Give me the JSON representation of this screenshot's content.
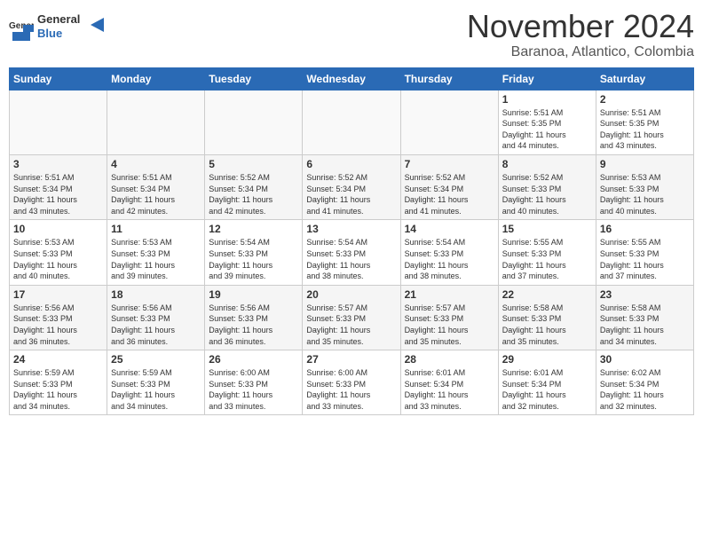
{
  "logo": {
    "general": "General",
    "blue": "Blue"
  },
  "title": "November 2024",
  "subtitle": "Baranoa, Atlantico, Colombia",
  "weekdays": [
    "Sunday",
    "Monday",
    "Tuesday",
    "Wednesday",
    "Thursday",
    "Friday",
    "Saturday"
  ],
  "weeks": [
    [
      {
        "day": "",
        "info": ""
      },
      {
        "day": "",
        "info": ""
      },
      {
        "day": "",
        "info": ""
      },
      {
        "day": "",
        "info": ""
      },
      {
        "day": "",
        "info": ""
      },
      {
        "day": "1",
        "info": "Sunrise: 5:51 AM\nSunset: 5:35 PM\nDaylight: 11 hours\nand 44 minutes."
      },
      {
        "day": "2",
        "info": "Sunrise: 5:51 AM\nSunset: 5:35 PM\nDaylight: 11 hours\nand 43 minutes."
      }
    ],
    [
      {
        "day": "3",
        "info": "Sunrise: 5:51 AM\nSunset: 5:34 PM\nDaylight: 11 hours\nand 43 minutes."
      },
      {
        "day": "4",
        "info": "Sunrise: 5:51 AM\nSunset: 5:34 PM\nDaylight: 11 hours\nand 42 minutes."
      },
      {
        "day": "5",
        "info": "Sunrise: 5:52 AM\nSunset: 5:34 PM\nDaylight: 11 hours\nand 42 minutes."
      },
      {
        "day": "6",
        "info": "Sunrise: 5:52 AM\nSunset: 5:34 PM\nDaylight: 11 hours\nand 41 minutes."
      },
      {
        "day": "7",
        "info": "Sunrise: 5:52 AM\nSunset: 5:34 PM\nDaylight: 11 hours\nand 41 minutes."
      },
      {
        "day": "8",
        "info": "Sunrise: 5:52 AM\nSunset: 5:33 PM\nDaylight: 11 hours\nand 40 minutes."
      },
      {
        "day": "9",
        "info": "Sunrise: 5:53 AM\nSunset: 5:33 PM\nDaylight: 11 hours\nand 40 minutes."
      }
    ],
    [
      {
        "day": "10",
        "info": "Sunrise: 5:53 AM\nSunset: 5:33 PM\nDaylight: 11 hours\nand 40 minutes."
      },
      {
        "day": "11",
        "info": "Sunrise: 5:53 AM\nSunset: 5:33 PM\nDaylight: 11 hours\nand 39 minutes."
      },
      {
        "day": "12",
        "info": "Sunrise: 5:54 AM\nSunset: 5:33 PM\nDaylight: 11 hours\nand 39 minutes."
      },
      {
        "day": "13",
        "info": "Sunrise: 5:54 AM\nSunset: 5:33 PM\nDaylight: 11 hours\nand 38 minutes."
      },
      {
        "day": "14",
        "info": "Sunrise: 5:54 AM\nSunset: 5:33 PM\nDaylight: 11 hours\nand 38 minutes."
      },
      {
        "day": "15",
        "info": "Sunrise: 5:55 AM\nSunset: 5:33 PM\nDaylight: 11 hours\nand 37 minutes."
      },
      {
        "day": "16",
        "info": "Sunrise: 5:55 AM\nSunset: 5:33 PM\nDaylight: 11 hours\nand 37 minutes."
      }
    ],
    [
      {
        "day": "17",
        "info": "Sunrise: 5:56 AM\nSunset: 5:33 PM\nDaylight: 11 hours\nand 36 minutes."
      },
      {
        "day": "18",
        "info": "Sunrise: 5:56 AM\nSunset: 5:33 PM\nDaylight: 11 hours\nand 36 minutes."
      },
      {
        "day": "19",
        "info": "Sunrise: 5:56 AM\nSunset: 5:33 PM\nDaylight: 11 hours\nand 36 minutes."
      },
      {
        "day": "20",
        "info": "Sunrise: 5:57 AM\nSunset: 5:33 PM\nDaylight: 11 hours\nand 35 minutes."
      },
      {
        "day": "21",
        "info": "Sunrise: 5:57 AM\nSunset: 5:33 PM\nDaylight: 11 hours\nand 35 minutes."
      },
      {
        "day": "22",
        "info": "Sunrise: 5:58 AM\nSunset: 5:33 PM\nDaylight: 11 hours\nand 35 minutes."
      },
      {
        "day": "23",
        "info": "Sunrise: 5:58 AM\nSunset: 5:33 PM\nDaylight: 11 hours\nand 34 minutes."
      }
    ],
    [
      {
        "day": "24",
        "info": "Sunrise: 5:59 AM\nSunset: 5:33 PM\nDaylight: 11 hours\nand 34 minutes."
      },
      {
        "day": "25",
        "info": "Sunrise: 5:59 AM\nSunset: 5:33 PM\nDaylight: 11 hours\nand 34 minutes."
      },
      {
        "day": "26",
        "info": "Sunrise: 6:00 AM\nSunset: 5:33 PM\nDaylight: 11 hours\nand 33 minutes."
      },
      {
        "day": "27",
        "info": "Sunrise: 6:00 AM\nSunset: 5:33 PM\nDaylight: 11 hours\nand 33 minutes."
      },
      {
        "day": "28",
        "info": "Sunrise: 6:01 AM\nSunset: 5:34 PM\nDaylight: 11 hours\nand 33 minutes."
      },
      {
        "day": "29",
        "info": "Sunrise: 6:01 AM\nSunset: 5:34 PM\nDaylight: 11 hours\nand 32 minutes."
      },
      {
        "day": "30",
        "info": "Sunrise: 6:02 AM\nSunset: 5:34 PM\nDaylight: 11 hours\nand 32 minutes."
      }
    ]
  ]
}
